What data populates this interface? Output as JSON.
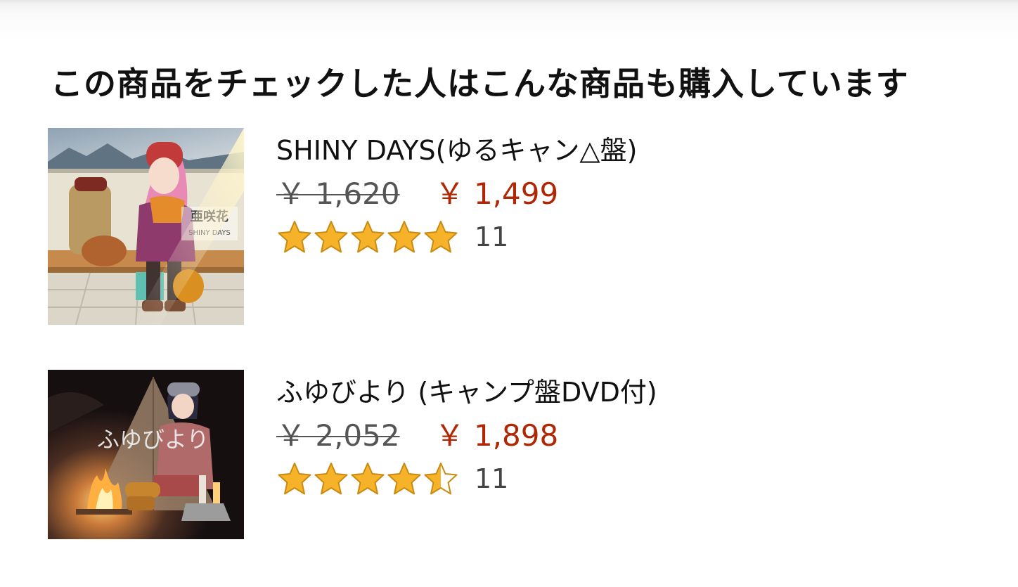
{
  "section": {
    "title": "この商品をチェックした人はこんな商品も購入しています"
  },
  "colors": {
    "title_text": "#111111",
    "old_price": "#555555",
    "sale_price": "#b12704",
    "star_fill": "#f6b32a",
    "star_stroke": "#c98a12"
  },
  "products": [
    {
      "title": "SHINY DAYS(ゆるキャン△盤)",
      "list_price": "￥ 1,620",
      "sale_price": "￥ 1,499",
      "rating_stars": 5,
      "rating_count": "11",
      "thumbnail_icon": "album-cover-shiny-days",
      "cover_text": {
        "logo": "亜咲花",
        "subtitle": "SHINY DAYS"
      }
    },
    {
      "title": "ふゆびより (キャンプ盤DVD付)",
      "list_price": "￥ 2,052",
      "sale_price": "￥ 1,898",
      "rating_stars": 4.5,
      "rating_count": "11",
      "thumbnail_icon": "album-cover-fuyubiyori",
      "cover_text": {
        "logo": "ふゆびより"
      }
    }
  ]
}
